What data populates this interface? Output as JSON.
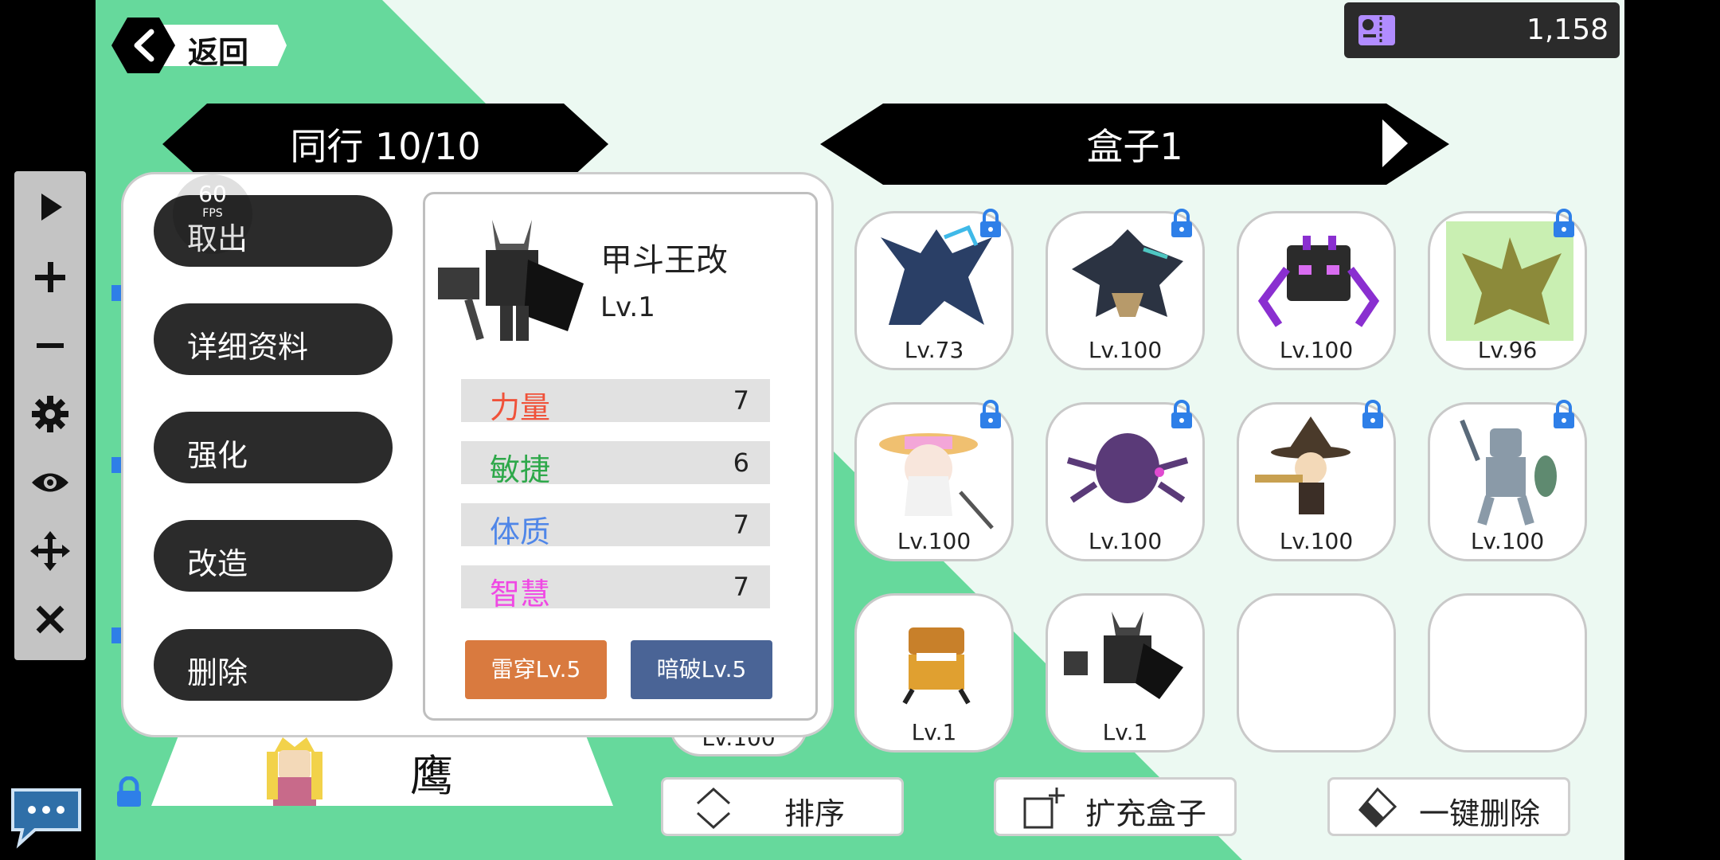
{
  "nav": {
    "back_label": "返回"
  },
  "currency": {
    "amount": "1,158",
    "icon": "ticket-icon",
    "icon_color": "#b18cff"
  },
  "party": {
    "title": "同行 10/10",
    "peek_level": "Lv.100",
    "peek_name": "鹰"
  },
  "box": {
    "title": "盒子1"
  },
  "popup": {
    "fps": "60",
    "fps_label": "FPS",
    "menu": [
      "取出",
      "详细资料",
      "强化",
      "改造",
      "删除"
    ],
    "monster": {
      "name": "甲斗王改",
      "level": "Lv.1",
      "stats": [
        {
          "name": "力量",
          "value": "7",
          "color": "#f0523a"
        },
        {
          "name": "敏捷",
          "value": "6",
          "color": "#2ea84a"
        },
        {
          "name": "体质",
          "value": "7",
          "color": "#4f86e8"
        },
        {
          "name": "智慧",
          "value": "7",
          "color": "#f048e4"
        }
      ],
      "skills": [
        {
          "label": "雷穿Lv.5",
          "color": "#d97a3f"
        },
        {
          "label": "暗破Lv.5",
          "color": "#4a6496"
        }
      ]
    }
  },
  "grid": [
    {
      "level": "Lv.73",
      "locked": true
    },
    {
      "level": "Lv.100",
      "locked": true
    },
    {
      "level": "Lv.100",
      "locked": false
    },
    {
      "level": "Lv.96",
      "locked": true
    },
    {
      "level": "Lv.100",
      "locked": true
    },
    {
      "level": "Lv.100",
      "locked": true
    },
    {
      "level": "Lv.100",
      "locked": true
    },
    {
      "level": "Lv.100",
      "locked": true
    },
    {
      "level": "Lv.1",
      "locked": false
    },
    {
      "level": "Lv.1",
      "locked": false
    },
    {
      "level": "",
      "locked": false
    },
    {
      "level": "",
      "locked": false
    }
  ],
  "actions": {
    "sort": "排序",
    "expand": "扩充盒子",
    "delete_all": "一键删除"
  },
  "colors": {
    "accent_green": "#66d99c",
    "panel_dark": "#2b2b2b",
    "lock_blue": "#2e7fe8"
  }
}
